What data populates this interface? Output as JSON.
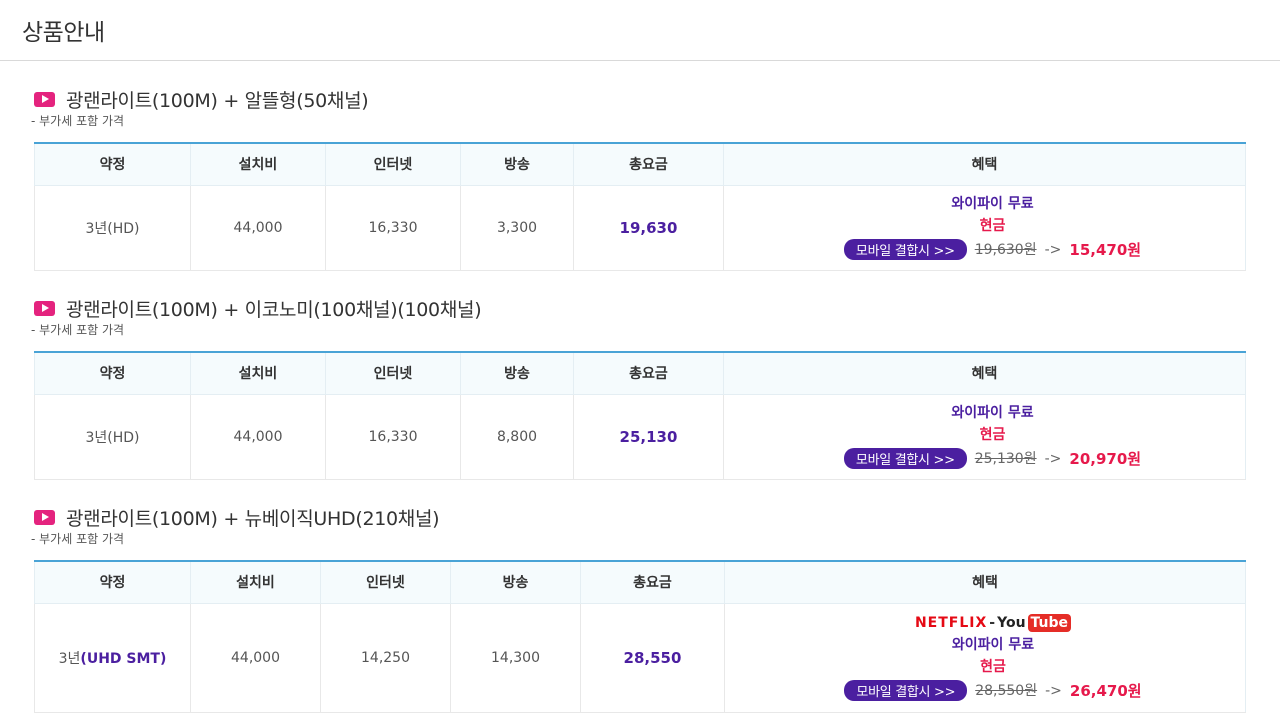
{
  "page": {
    "title": "상품안내"
  },
  "colors": {
    "accent_blue": "#49a3d6",
    "purple": "#4b1fa0",
    "pink": "#e4237e",
    "red": "#e6194b"
  },
  "icons": {
    "product_marker": "play-icon"
  },
  "columns": [
    "약정",
    "설치비",
    "인터넷",
    "방송",
    "총요금",
    "혜택"
  ],
  "products": [
    {
      "title": "광랜라이트(100M) + 알뜰형(50채널)",
      "note": "- 부가세 포함 가격",
      "contract_prefix": "3년",
      "contract_suffix": "(HD)",
      "install": "44,000",
      "internet": "16,330",
      "tv": "3,300",
      "total": "19,630",
      "benefit": {
        "wifi": "와이파이 무료",
        "cash": "현금",
        "mobile_button": "모바일 결합시 >>",
        "old_price": "19,630원",
        "arrow": "->",
        "new_price": "15,470원"
      }
    },
    {
      "title": "광랜라이트(100M) + 이코노미(100채널)(100채널)",
      "note": "- 부가세 포함 가격",
      "contract_prefix": "3년",
      "contract_suffix": "(HD)",
      "install": "44,000",
      "internet": "16,330",
      "tv": "8,800",
      "total": "25,130",
      "benefit": {
        "wifi": "와이파이 무료",
        "cash": "현금",
        "mobile_button": "모바일 결합시 >>",
        "old_price": "25,130원",
        "arrow": "->",
        "new_price": "20,970원"
      }
    },
    {
      "title": "광랜라이트(100M) + 뉴베이직UHD(210채널)",
      "note": "- 부가세 포함 가격",
      "contract_prefix": "3년",
      "contract_suffix": "(UHD SMT)",
      "install": "44,000",
      "internet": "14,250",
      "tv": "14,300",
      "total": "28,550",
      "benefit": {
        "logo_netflix": "NETFLIX",
        "logo_sep": "-",
        "logo_you": "You",
        "logo_tube": "Tube",
        "wifi": "와이파이 무료",
        "cash": "현금",
        "mobile_button": "모바일 결합시 >>",
        "old_price": "28,550원",
        "arrow": "->",
        "new_price": "26,470원"
      }
    }
  ]
}
